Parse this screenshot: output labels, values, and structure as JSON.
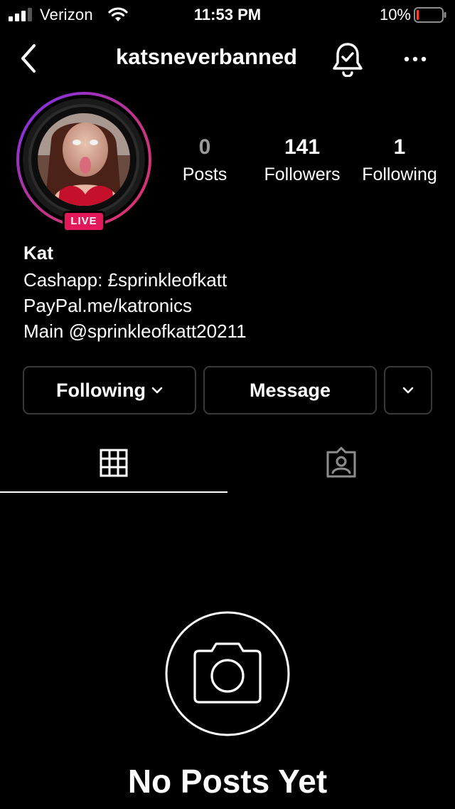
{
  "status_bar": {
    "carrier": "Verizon",
    "time": "11:53 PM",
    "battery_percent": "10%",
    "battery_level": 0.1,
    "icons": [
      "signal-icon",
      "wifi-icon",
      "battery-icon"
    ]
  },
  "header": {
    "username": "katsneverbanned",
    "icons": [
      "back-icon",
      "bell-check-icon",
      "more-icon"
    ]
  },
  "profile": {
    "live_badge": "LIVE",
    "stats": [
      {
        "value": "0",
        "label": "Posts"
      },
      {
        "value": "141",
        "label": "Followers"
      },
      {
        "value": "1",
        "label": "Following"
      }
    ],
    "name": "Kat",
    "bio": [
      "Cashapp: £sprinkleofkatt",
      "PayPal.me/katronics",
      "Main @sprinkleofkatt20211"
    ]
  },
  "actions": {
    "following_label": "Following",
    "message_label": "Message",
    "icons": [
      "chevron-down-icon"
    ]
  },
  "tabs": {
    "items": [
      "grid-icon",
      "tagged-icon"
    ],
    "selected": 0
  },
  "empty_state": {
    "title": "No Posts Yet",
    "icon": "camera-icon"
  },
  "colors": {
    "background": "#000000",
    "live_badge": "#e2185a",
    "battery_low": "#ff3b30",
    "ring_start": "#7b2ff7",
    "ring_end": "#e1306c"
  }
}
